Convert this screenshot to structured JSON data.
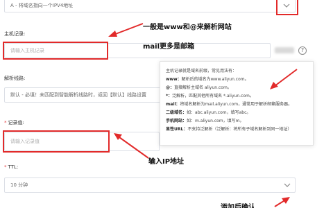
{
  "record_type": {
    "value": "A - 将域名指向一个IPV4地址"
  },
  "host_record": {
    "label": "主机记录:",
    "placeholder": "请输入主机记录"
  },
  "resolve_line": {
    "label": "解析线路:",
    "value": "默认 - 必填！未匹配到智能解析线路时，返回【默认】线路设置"
  },
  "record_value": {
    "label": "记录值:",
    "placeholder": "请输入记录值"
  },
  "ttl": {
    "label": "TTL:",
    "value": "10 分钟"
  },
  "annotations": {
    "www_at": "一般是www和@来解析网站",
    "mail": "mail更多是邮箱",
    "ip": "输入IP地址",
    "confirm": "添加后确认"
  },
  "tooltip": {
    "intro": "主机记录就是域名前缀，常见用法有：",
    "lines": [
      {
        "key": "www：",
        "text": "解析后的域名为www.aliyun.com。"
      },
      {
        "key": "@：",
        "text": "直接解析主域名 aliyun.com。"
      },
      {
        "key": "*：",
        "text": "泛解析，匹配其他所有域名 *.aliyun.com。"
      },
      {
        "key": "mail：",
        "text": "将域名解析为mail.aliyun.com，通常用于解析邮箱服务器。"
      },
      {
        "key": "二级域名：",
        "text": "如：abc.aliyun.com，填写abc。"
      },
      {
        "key": "手机网站：",
        "text": "如：m.aliyun.com，填写m。"
      },
      {
        "key": "显性URL：",
        "text": "不支持泛解析（泛解析：将所有子域名解析到同一地址）"
      }
    ]
  },
  "icons": {
    "dropdown": "chevron-down-icon",
    "help": "question-circle-icon"
  },
  "colors": {
    "annotation_red": "#e22a2a",
    "required": "#e4393c"
  }
}
